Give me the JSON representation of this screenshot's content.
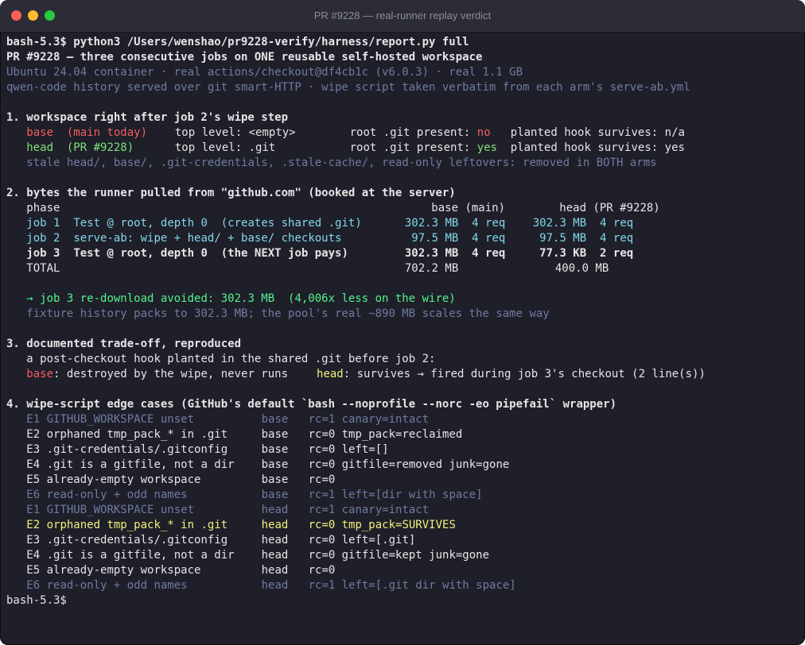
{
  "window": {
    "title": "PR #9228 — real-runner replay verdict",
    "controls": {
      "close_color": "#ff5f57",
      "minimize_color": "#febc2e",
      "zoom_color": "#28c840"
    }
  },
  "terminal": {
    "prompt1": "bash-5.3$ python3 /Users/wenshao/pr9228-verify/harness/report.py full",
    "header_title": "PR #9228 — three consecutive jobs on ONE reusable self-hosted workspace",
    "header_env": "Ubuntu 24.04 container · real actions/checkout@df4cb1c (v6.0.3) · real 1.1 GB",
    "header_source": "qwen-code history served over git smart-HTTP · wipe script taken verbatim from each arm's serve-ab.yml",
    "s1": {
      "title": "1. workspace right after job 2's wipe step",
      "base": {
        "name": "base",
        "tag": "(main today)",
        "top_label": "top level:",
        "top_value": "<empty>",
        "git_label": "root .git present:",
        "git_value": "no",
        "hook_label": "planted hook survives:",
        "hook_value": "n/a"
      },
      "head": {
        "name": "head",
        "tag": "(PR #9228)",
        "top_label": "top level:",
        "top_value": ".git",
        "git_label": "root .git present:",
        "git_value": "yes",
        "hook_label": "planted hook survives:",
        "hook_value": "yes"
      },
      "note": "stale head/, base/, .git-credentials, .stale-cache/, read-only leftovers: removed in BOTH arms"
    },
    "s2": {
      "title": "2. bytes the runner pulled from \"github.com\" (booked at the server)",
      "col_phase": "phase",
      "col_base": "base (main)",
      "col_head": "head (PR #9228)",
      "rows": [
        {
          "job": "job 1",
          "desc": "Test @ root, depth 0  (creates shared .git)",
          "base_size": "302.3 MB",
          "base_req": "4 req",
          "head_size": "302.3 MB",
          "head_req": "4 req"
        },
        {
          "job": "job 2",
          "desc": "serve-ab: wipe + head/ + base/ checkouts",
          "base_size": "97.5 MB",
          "base_req": "4 req",
          "head_size": "97.5 MB",
          "head_req": "4 req"
        },
        {
          "job": "job 3",
          "desc": "Test @ root, depth 0  (the NEXT job pays)",
          "base_size": "302.3 MB",
          "base_req": "4 req",
          "head_size": "77.3 KB",
          "head_req": "2 req"
        }
      ],
      "total_label": "TOTAL",
      "total_base": "702.2 MB",
      "total_head": "400.0 MB",
      "avoided": "→ job 3 re-download avoided: 302.3 MB  (4,006x less on the wire)",
      "note": "fixture history packs to 302.3 MB; the pool's real ~890 MB scales the same way"
    },
    "s3": {
      "title": "3. documented trade-off, reproduced",
      "line1": "a post-checkout hook planted in the shared .git before job 2:",
      "base_label": "base",
      "base_text": ": destroyed by the wipe, never runs",
      "head_label": "head",
      "head_text": ": survives → fired during job 3's checkout (2 line(s))"
    },
    "s4": {
      "title": "4. wipe-script edge cases (GitHub's default `bash --noprofile --norc -eo pipefail` wrapper)",
      "rows": [
        {
          "id": "E1",
          "name": "GITHUB_WORKSPACE unset",
          "arm": "base",
          "rc": "rc=1",
          "result": "canary=intact",
          "style": "dim"
        },
        {
          "id": "E2",
          "name": "orphaned tmp_pack_* in .git",
          "arm": "base",
          "rc": "rc=0",
          "result": "tmp_pack=reclaimed",
          "style": "w"
        },
        {
          "id": "E3",
          "name": ".git-credentials/.gitconfig",
          "arm": "base",
          "rc": "rc=0",
          "result": "left=[]",
          "style": "w"
        },
        {
          "id": "E4",
          "name": ".git is a gitfile, not a dir",
          "arm": "base",
          "rc": "rc=0",
          "result": "gitfile=removed junk=gone",
          "style": "w"
        },
        {
          "id": "E5",
          "name": "already-empty workspace",
          "arm": "base",
          "rc": "rc=0",
          "result": "",
          "style": "w"
        },
        {
          "id": "E6",
          "name": "read-only + odd names",
          "arm": "base",
          "rc": "rc=1",
          "result": "left=[dir with space]",
          "style": "dim"
        },
        {
          "id": "E1",
          "name": "GITHUB_WORKSPACE unset",
          "arm": "head",
          "rc": "rc=1",
          "result": "canary=intact",
          "style": "dim"
        },
        {
          "id": "E2",
          "name": "orphaned tmp_pack_* in .git",
          "arm": "head",
          "rc": "rc=0",
          "result": "tmp_pack=SURVIVES",
          "style": "ylw"
        },
        {
          "id": "E3",
          "name": ".git-credentials/.gitconfig",
          "arm": "head",
          "rc": "rc=0",
          "result": "left=[.git]",
          "style": "w"
        },
        {
          "id": "E4",
          "name": ".git is a gitfile, not a dir",
          "arm": "head",
          "rc": "rc=0",
          "result": "gitfile=kept junk=gone",
          "style": "w"
        },
        {
          "id": "E5",
          "name": "already-empty workspace",
          "arm": "head",
          "rc": "rc=0",
          "result": "",
          "style": "w"
        },
        {
          "id": "E6",
          "name": "read-only + odd names",
          "arm": "head",
          "rc": "rc=1",
          "result": "left=[.git dir with space]",
          "style": "dim"
        }
      ]
    },
    "prompt2": "bash-5.3$"
  },
  "colors": {
    "background": "#1e1f29",
    "titlebar": "#2b2c36",
    "dim_text": "#6f7ba1",
    "red": "#f45d5d",
    "green": "#7ee07e",
    "yellow": "#f3f07c",
    "cyan": "#85d7ea",
    "bright_green": "#52f28c"
  }
}
